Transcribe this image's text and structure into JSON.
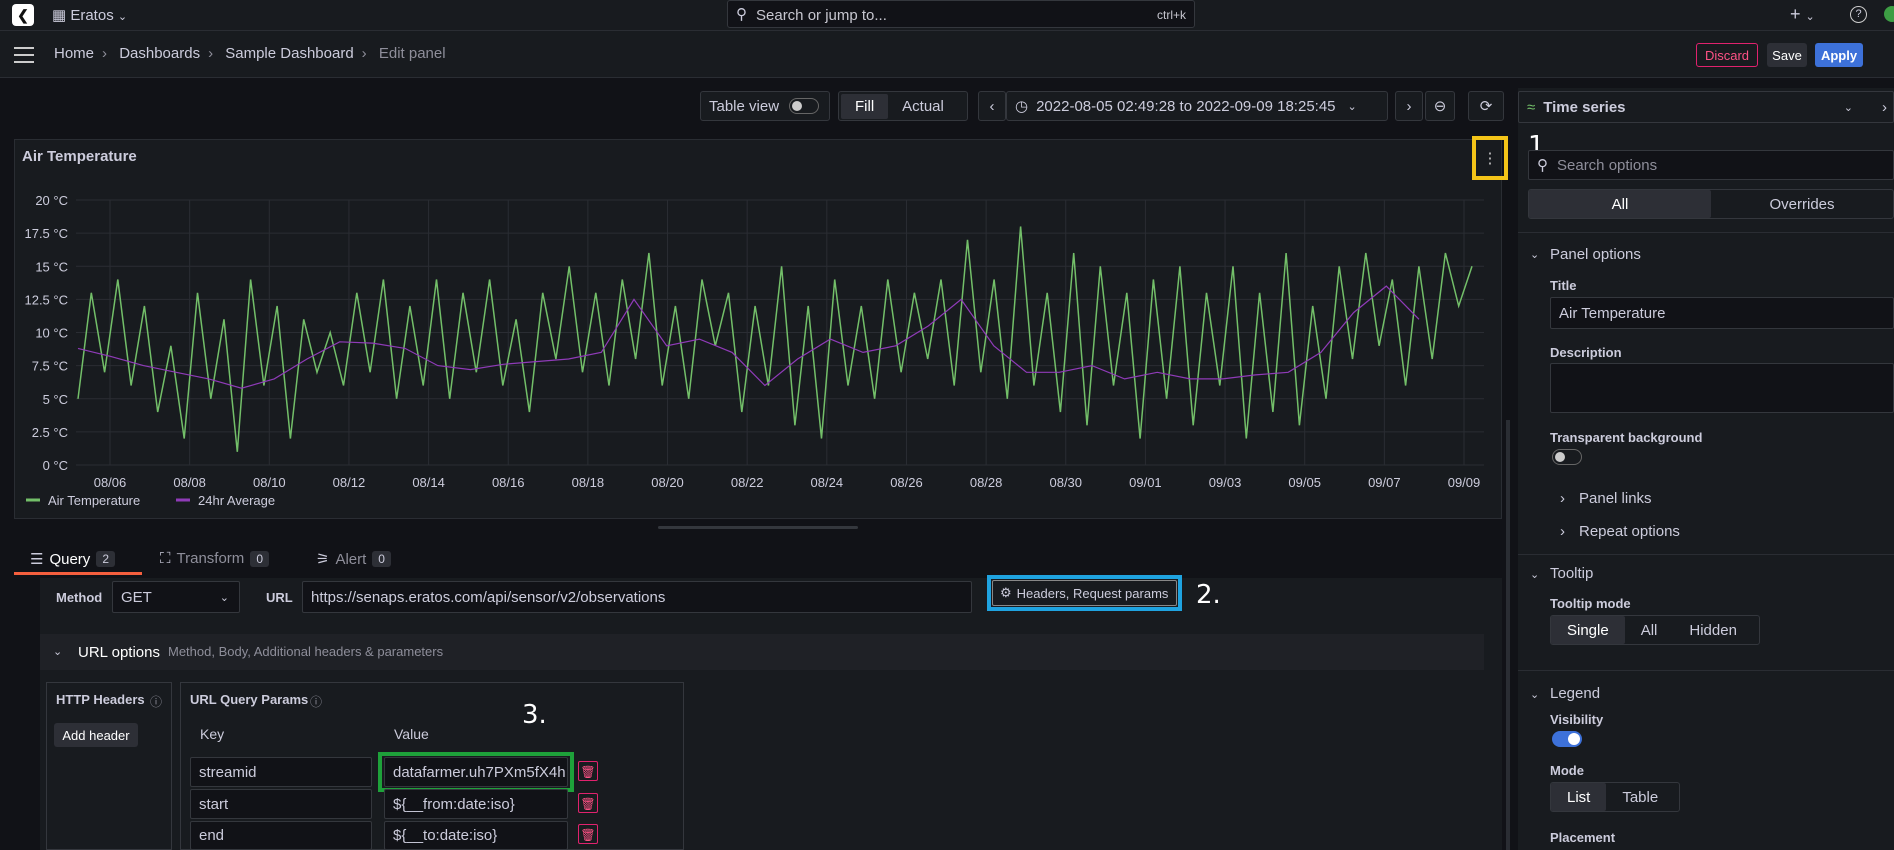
{
  "topbar": {
    "org": "Eratos",
    "search_placeholder": "Search or jump to...",
    "shortcut": "ctrl+k"
  },
  "breadcrumb": [
    "Home",
    "Dashboards",
    "Sample Dashboard",
    "Edit panel"
  ],
  "actions": {
    "discard": "Discard",
    "save": "Save",
    "apply": "Apply"
  },
  "toolbar": {
    "table_view": "Table view",
    "fill": "Fill",
    "actual": "Actual",
    "time_range": "2022-08-05 02:49:28 to 2022-09-09 18:25:45"
  },
  "panel": {
    "title": "Air Temperature"
  },
  "chart_data": {
    "type": "line",
    "ylim": [
      0,
      20
    ],
    "y_ticks": [
      "0 °C",
      "2.5 °C",
      "5 °C",
      "7.5 °C",
      "10 °C",
      "12.5 °C",
      "15 °C",
      "17.5 °C",
      "20 °C"
    ],
    "x_ticks": [
      "08/06",
      "08/08",
      "08/10",
      "08/12",
      "08/14",
      "08/16",
      "08/18",
      "08/20",
      "08/22",
      "08/24",
      "08/26",
      "08/28",
      "08/30",
      "09/01",
      "09/03",
      "09/05",
      "09/07",
      "09/09"
    ],
    "series": [
      {
        "name": "Air Temperature",
        "color": "#73bf69",
        "values": [
          5,
          13,
          7,
          14,
          6,
          12,
          4,
          9,
          2,
          13,
          5,
          11,
          1,
          14,
          6,
          12,
          2,
          11,
          7,
          10,
          6,
          13,
          7,
          14,
          5,
          12,
          6,
          14,
          5,
          13,
          7,
          14,
          6,
          11,
          4,
          13,
          8,
          15,
          7,
          13,
          6,
          14,
          8,
          16,
          6,
          12,
          5,
          14,
          9,
          13,
          4,
          12,
          6,
          15,
          3,
          12,
          2,
          14,
          6,
          12,
          5,
          14,
          7,
          13,
          8,
          14,
          6,
          17,
          7,
          14,
          5,
          18,
          6,
          13,
          4,
          16,
          3,
          15,
          6,
          13,
          2,
          14,
          5,
          15,
          3,
          13,
          6,
          15,
          2,
          13,
          4,
          16,
          3,
          12,
          5,
          15,
          8,
          16,
          9,
          14,
          6,
          15,
          8,
          16,
          12,
          15
        ]
      },
      {
        "name": "24hr Average",
        "color": "#8f3bb8",
        "values": [
          8.8,
          8.2,
          7.5,
          7,
          6.5,
          5.8,
          6.5,
          8,
          9.3,
          9.2,
          8.8,
          7.5,
          7.2,
          7.6,
          7.8,
          8,
          8.5,
          12.5,
          9,
          9.5,
          8.5,
          6,
          8,
          9.5,
          8.5,
          9,
          10.5,
          12.5,
          9,
          7,
          7,
          7.5,
          6.5,
          7,
          6.5,
          6.5,
          6.8,
          7,
          8.5,
          11.5,
          13.5,
          11
        ]
      }
    ]
  },
  "tabs": {
    "query": "Query",
    "query_count": "2",
    "transform": "Transform",
    "transform_count": "0",
    "alert": "Alert",
    "alert_count": "0"
  },
  "query": {
    "method_label": "Method",
    "method": "GET",
    "url_label": "URL",
    "url": "https://senaps.eratos.com/api/sensor/v2/observations",
    "headers_btn": "Headers, Request params",
    "url_options": "URL options",
    "url_options_desc": "Method, Body, Additional headers & parameters",
    "http_headers": "HTTP Headers",
    "add_header": "Add header",
    "url_query_params": "URL Query Params",
    "key_label": "Key",
    "value_label": "Value",
    "params": [
      {
        "key": "streamid",
        "value": "datafarmer.uh7PXm5fX4h"
      },
      {
        "key": "start",
        "value": "${__from:date:iso}"
      },
      {
        "key": "end",
        "value": "${__to:date:iso}"
      }
    ]
  },
  "options": {
    "viz": "Time series",
    "search_placeholder": "Search options",
    "all": "All",
    "overrides": "Overrides",
    "panel_options": "Panel options",
    "title_label": "Title",
    "title_value": "Air Temperature",
    "description_label": "Description",
    "transparent": "Transparent background",
    "panel_links": "Panel links",
    "repeat_options": "Repeat options",
    "tooltip": "Tooltip",
    "tooltip_mode": "Tooltip mode",
    "single": "Single",
    "all_mode": "All",
    "hidden": "Hidden",
    "legend": "Legend",
    "visibility": "Visibility",
    "mode": "Mode",
    "list": "List",
    "table": "Table",
    "placement": "Placement"
  },
  "annotations": {
    "one": "1.",
    "two": "2.",
    "three": "3."
  }
}
